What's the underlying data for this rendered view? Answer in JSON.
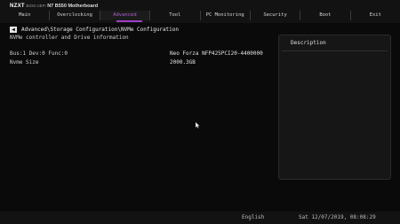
{
  "header": {
    "logo": "NZXT",
    "bios": "BIOS UEFI",
    "model": "N7 B550 Motherboard"
  },
  "tabs": [
    {
      "label": "Main",
      "active": false
    },
    {
      "label": "Overclocking",
      "active": false
    },
    {
      "label": "Advanced",
      "active": true
    },
    {
      "label": "Tool",
      "active": false
    },
    {
      "label": "PC Monitoring",
      "active": false
    },
    {
      "label": "Security",
      "active": false
    },
    {
      "label": "Boot",
      "active": false
    },
    {
      "label": "Exit",
      "active": false
    }
  ],
  "breadcrumb": "Advanced\\Storage Configuration\\NVMe Configuration",
  "subtitle": "NVMe controller and Drive information",
  "rows": [
    {
      "key": "Bus:1 Dev:0 Func:0",
      "value": "Neo Forza NFP425PCI20-4400000"
    },
    {
      "key": "Nvme Size",
      "value": "2000.3GB"
    }
  ],
  "description": {
    "title": "Description"
  },
  "status": {
    "language": "English",
    "datetime": "Sat 12/07/2019, 08:08:29"
  },
  "colors": {
    "accent": "#a13ec8",
    "active_tab_text": "#b35fd3",
    "background": "#0a0a0a"
  }
}
